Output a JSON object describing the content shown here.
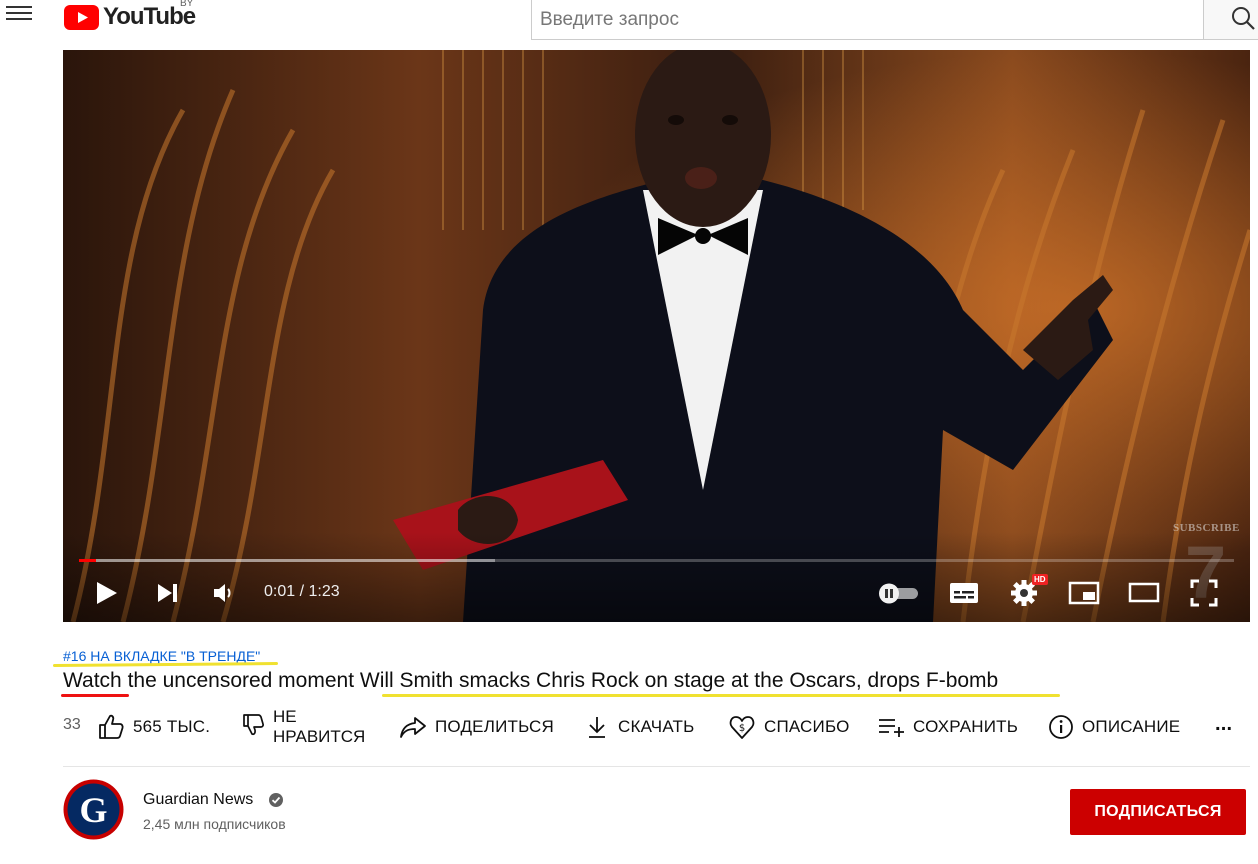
{
  "header": {
    "logo_text": "YouTube",
    "country_code": "BY",
    "search_placeholder": "Введите запрос"
  },
  "player": {
    "time_display": "0:01 / 1:23",
    "progress_played_fraction": 0.015,
    "progress_loaded_fraction": 0.36,
    "watermark_text": "SUBSCRIBE",
    "hd_badge": "HD"
  },
  "video": {
    "trending_tag": "#16 НА ВКЛАДКЕ \"В ТРЕНДЕ\"",
    "title_word_first": "Watch",
    "title_middle": " the uncensored moment ",
    "title_highlight": "Will Smith smacks Chris Rock on stage at the Oscars, drops F-bomb"
  },
  "actions": {
    "views_partial": "33",
    "like_count": "565 ТЫС.",
    "dislike_line1": "НЕ",
    "dislike_line2": "НРАВИТСЯ",
    "share": "ПОДЕЛИТЬСЯ",
    "download": "СКАЧАТЬ",
    "thanks": "СПАСИБО",
    "save": "СОХРАНИТЬ",
    "description": "ОПИСАНИЕ",
    "more": "..."
  },
  "channel": {
    "name": "Guardian News",
    "subscribers": "2,45 млн подписчиков",
    "avatar_letter": "G",
    "subscribe_label": "ПОДПИСАТЬСЯ"
  },
  "colors": {
    "brand_red": "#ff0000",
    "subscribe_red": "#cc0000",
    "link_blue": "#065fd4",
    "highlight_yellow": "#f0e130",
    "guardian_navy": "#052962"
  }
}
